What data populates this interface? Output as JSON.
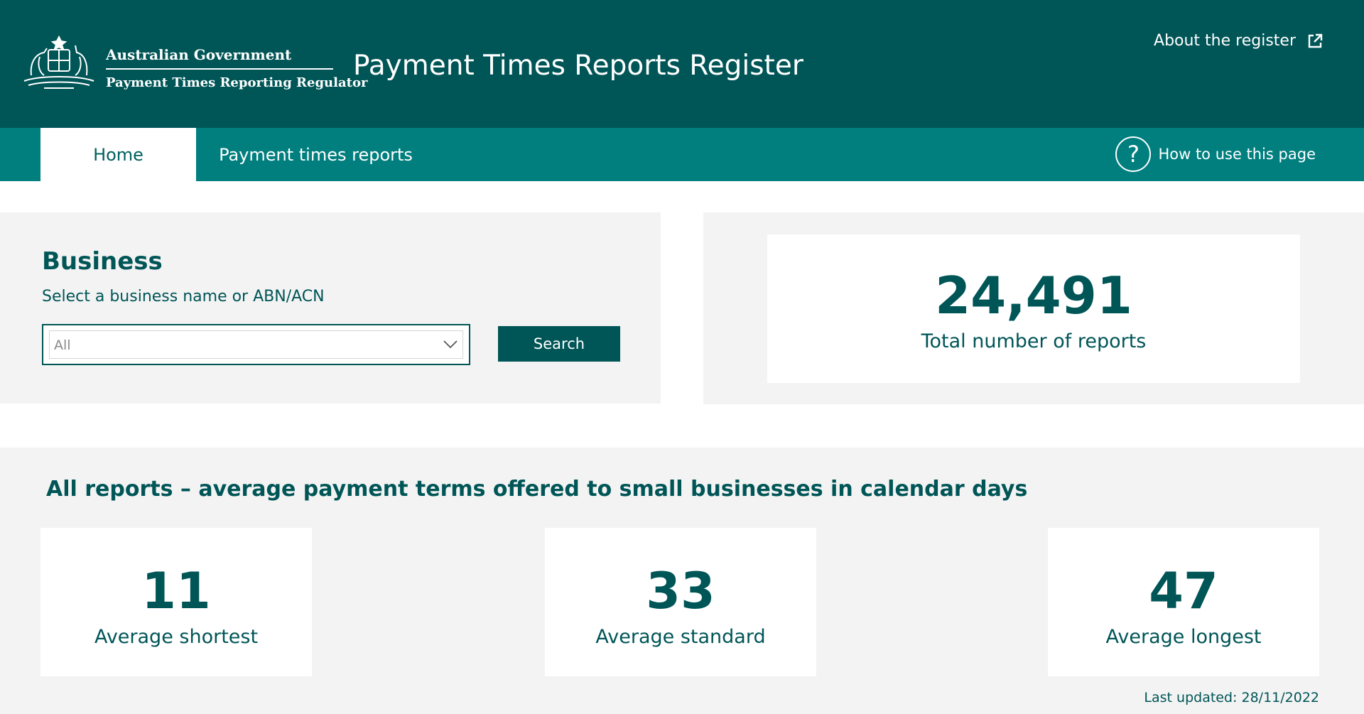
{
  "header": {
    "gov_name": "Australian Government",
    "agency": "Payment Times Reporting Regulator",
    "title": "Payment Times Reports Register",
    "about_link": "About the register"
  },
  "nav": {
    "tabs": [
      {
        "label": "Home",
        "active": true
      },
      {
        "label": "Payment times reports",
        "active": false
      }
    ],
    "help": "How to use this page"
  },
  "business": {
    "title": "Business",
    "subtitle": "Select a business name or ABN/ACN",
    "select_value": "All",
    "search_label": "Search"
  },
  "total": {
    "value": "24,491",
    "label": "Total number of reports"
  },
  "reports": {
    "heading": "All reports – average payment terms offered to small businesses in calendar days",
    "stats": [
      {
        "value": "11",
        "label": "Average shortest"
      },
      {
        "value": "33",
        "label": "Average standard"
      },
      {
        "value": "47",
        "label": "Average longest"
      }
    ],
    "last_updated": "Last updated: 28/11/2022"
  },
  "colors": {
    "header_bg": "#005557",
    "nav_bg": "#007f7e",
    "panel_bg": "#f3f3f3",
    "accent_text": "#005557"
  },
  "icons": [
    "coat-of-arms-logo",
    "external-link-icon",
    "help-circle-icon",
    "chevron-down-icon"
  ]
}
